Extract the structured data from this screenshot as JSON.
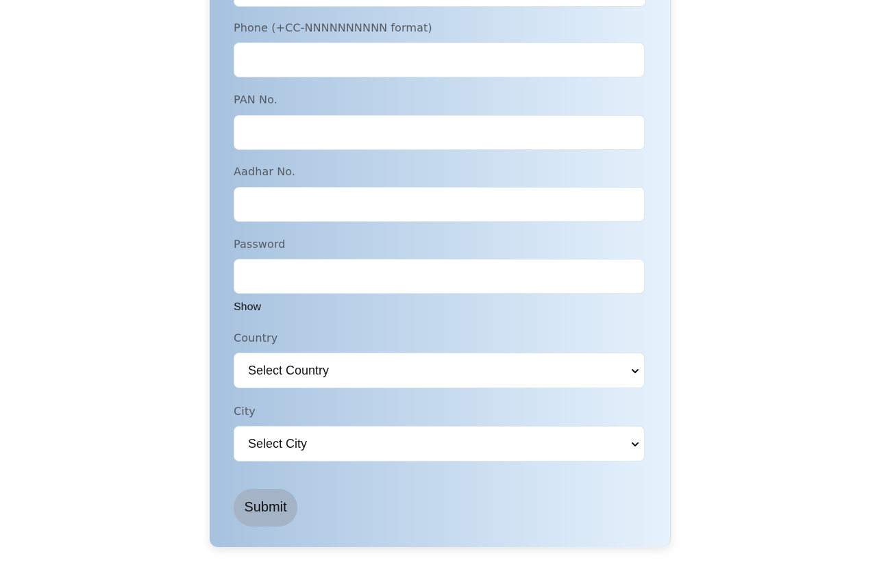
{
  "form": {
    "phone_label": "Phone (+CC-NNNNNNNNNN format)",
    "phone_value": "",
    "pan_label": "PAN No.",
    "pan_value": "",
    "aadhar_label": "Aadhar No.",
    "aadhar_value": "",
    "password_label": "Password",
    "password_value": "",
    "show_label": "Show",
    "country_label": "Country",
    "country_selected": "Select Country",
    "city_label": "City",
    "city_selected": "Select City",
    "submit_label": "Submit"
  },
  "icons": {
    "select_chevron": "chevron-down-icon"
  },
  "colors": {
    "card_gradient_start": "#a7c2df",
    "card_gradient_end": "#e6f2fd",
    "submit_bg": "#a4b3c6",
    "label_text": "#555a62"
  }
}
